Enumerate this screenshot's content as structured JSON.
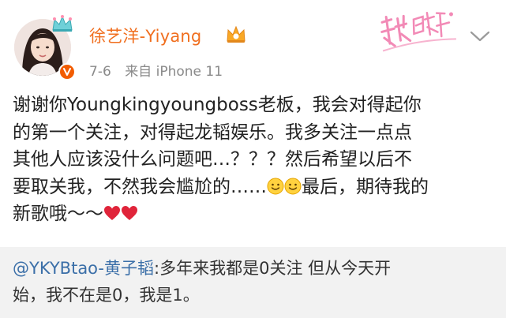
{
  "post": {
    "username": "徐艺洋-Yiyang",
    "date": "7-6",
    "source": "来自 iPhone 11",
    "body_lines": [
      {
        "parts": [
          {
            "t": "谢谢你Youngkingyoungboss老板，我会对得起你"
          }
        ]
      },
      {
        "parts": [
          {
            "t": "的第一个关注，对得起龙韬娱乐。我多关注一点点"
          }
        ]
      },
      {
        "parts": [
          {
            "t": "其他人应该没什么问题吧…？？？然后希望以后不"
          }
        ]
      },
      {
        "parts": [
          {
            "t": "要取关我，不然我会尴尬的……"
          },
          {
            "emoji": "smile"
          },
          {
            "emoji": "smile"
          },
          {
            "t": "最后，期待我的"
          }
        ]
      },
      {
        "parts": [
          {
            "t": "新歌哦～～"
          },
          {
            "emoji": "heart"
          },
          {
            "emoji": "heart"
          }
        ]
      }
    ]
  },
  "quote": {
    "mention": "@YKYBtao-黄子韬",
    "line1_rest": ":多年来我都是0关注 但从今天开",
    "line2": "始，我不在是0，我是1。"
  },
  "colors": {
    "username": "#f06e1e",
    "meta": "#8a8a8a",
    "mention": "#3b6fa8",
    "quote_bg": "#f2f2f2",
    "heart": "#e0243a",
    "vip": "#f25c02"
  },
  "icons": {
    "crown": "crown-icon",
    "vip": "vip-badge-icon",
    "member": "member-crown-icon",
    "more": "chevron-down-icon",
    "stamp": "decorative-stamp"
  }
}
